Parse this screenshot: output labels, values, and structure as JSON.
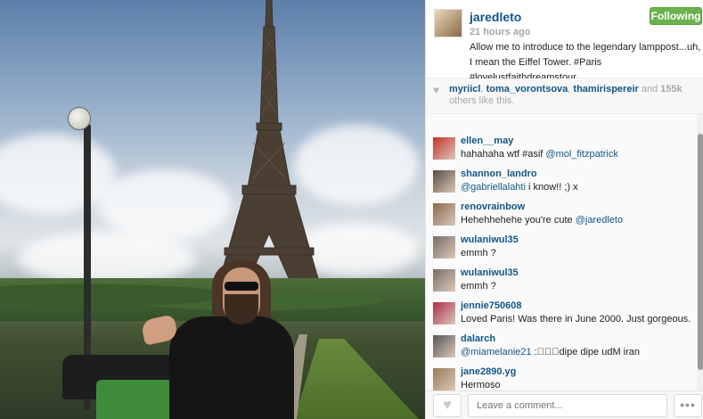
{
  "post": {
    "username": "jaredleto",
    "follow_label": "Following",
    "time": "21 hours ago",
    "caption": "Allow me to introduce to the legendary lamppost...uh, I mean the Eiffel Tower. #Paris #lovelustfaithdreamstour"
  },
  "likes": {
    "user1": "myriicl",
    "user2": "toma_vorontsova",
    "user3": "thamirispereir",
    "and": "and",
    "count": "155k",
    "suffix": "others like this.",
    "sep": ","
  },
  "comments": [
    {
      "user": "ellen__may",
      "pre": "hahahaha wtf #asif ",
      "mention": "@mol_fitzpatrick",
      "post": "",
      "avatar_color": "#c9302c"
    },
    {
      "user": "shannon_landro",
      "pre": "",
      "mention": "@gabriellalahti",
      "post": " i know!! ;) x",
      "avatar_color": "#5a4a40"
    },
    {
      "user": "renovrainbow",
      "pre": "Hehehhehehe you're cute ",
      "mention": "@jaredleto",
      "post": "",
      "avatar_color": "#8a6a50"
    },
    {
      "user": "wulaniwul35",
      "pre": "emmh ?",
      "mention": "",
      "post": "",
      "avatar_color": "#7a6d66"
    },
    {
      "user": "wulaniwul35",
      "pre": "emmh ?",
      "mention": "",
      "post": "",
      "avatar_color": "#7a6d66"
    },
    {
      "user": "jennie750608",
      "pre": "Loved Paris! Was there in June 2000. Just gorgeous.",
      "mention": "",
      "post": "",
      "avatar_color": "#b02a4a"
    },
    {
      "user": "dalarch",
      "pre": "",
      "mention": "@miamelanie21",
      "post": " :\u0000\u0000\u0000dipe dipe udM iran",
      "avatar_color": "#555555"
    },
    {
      "user": "jane2890.yg",
      "pre": "Hermoso",
      "mention": "",
      "post": "",
      "avatar_color": "#9a7a5a"
    }
  ],
  "footer": {
    "comment_placeholder": "Leave a comment...",
    "more_label": "•••",
    "heart_icon": "heart-icon"
  },
  "colors": {
    "link": "#125688",
    "follow_green": "#6bb24f"
  }
}
